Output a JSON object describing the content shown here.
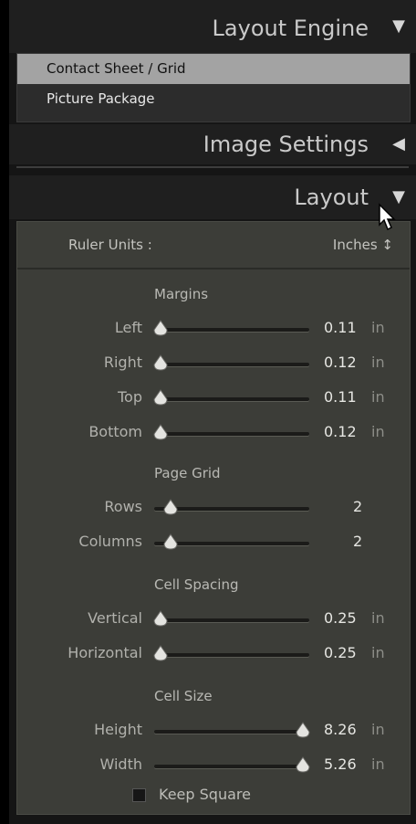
{
  "panels": {
    "layout_engine": {
      "title": "Layout Engine",
      "state_icon": "triangle-down"
    },
    "image_settings": {
      "title": "Image Settings",
      "state_icon": "triangle-left"
    },
    "layout": {
      "title": "Layout",
      "state_icon": "triangle-down"
    }
  },
  "engine_options": [
    {
      "label": "Contact Sheet / Grid",
      "selected": true
    },
    {
      "label": "Picture Package",
      "selected": false
    }
  ],
  "ruler": {
    "label": "Ruler Units :",
    "value": "Inches ↕"
  },
  "sections": {
    "margins": "Margins",
    "page_grid": "Page Grid",
    "cell_spacing": "Cell Spacing",
    "cell_size": "Cell Size"
  },
  "margins": [
    {
      "label": "Left",
      "value": "0.11",
      "unit": "in",
      "level": 0.0
    },
    {
      "label": "Right",
      "value": "0.12",
      "unit": "in",
      "level": 0.0
    },
    {
      "label": "Top",
      "value": "0.11",
      "unit": "in",
      "level": 0.0
    },
    {
      "label": "Bottom",
      "value": "0.12",
      "unit": "in",
      "level": 0.0
    }
  ],
  "page_grid": [
    {
      "label": "Rows",
      "value": "2",
      "level": 0.07
    },
    {
      "label": "Columns",
      "value": "2",
      "level": 0.07
    }
  ],
  "cell_spacing": [
    {
      "label": "Vertical",
      "value": "0.25",
      "unit": "in",
      "level": 0.0
    },
    {
      "label": "Horizontal",
      "value": "0.25",
      "unit": "in",
      "level": 0.0
    }
  ],
  "cell_size": [
    {
      "label": "Height",
      "value": "8.26",
      "unit": "in",
      "level": 1.0
    },
    {
      "label": "Width",
      "value": "5.26",
      "unit": "in",
      "level": 1.0
    }
  ],
  "keep_square": {
    "label": "Keep Square",
    "checked": false
  },
  "colors": {
    "panel_bg": "#151515",
    "header_bg": "#1f1f1f",
    "body_bg": "#3c3d38",
    "selected_row": "#a3a3a3"
  }
}
